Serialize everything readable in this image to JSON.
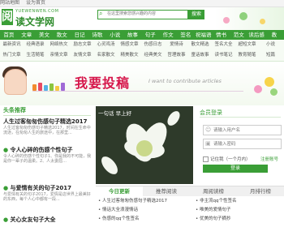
{
  "topbar": {
    "links": [
      "网站地图",
      "设为首页"
    ]
  },
  "header": {
    "logo_mark": "阅",
    "logo_url": "YUEWENWEN.COM",
    "logo_name": "读文学网",
    "search": {
      "placeholder": "在这里搜索您感兴趣的内容",
      "button": "搜索"
    }
  },
  "nav": [
    "首页",
    "文章",
    "美文",
    "散文",
    "日记",
    "诗歌",
    "小说",
    "故事",
    "句子",
    "作文",
    "签名",
    "祝福语",
    "情书",
    "范文",
    "读后感",
    "教"
  ],
  "subnav": [
    [
      "最新资讯",
      "经典语录",
      "网络热文",
      "励志文章",
      "心灵鸡汤",
      "情感文章",
      "伤感日志",
      "爱情诗",
      "散文精选",
      "签名大全",
      "超短文章",
      "小说"
    ],
    [
      "热门文章",
      "生活随笔",
      "亲情文章",
      "友情文章",
      "名家散文",
      "精美散文",
      "经典美文",
      "哲理故事",
      "童话故事",
      "读书笔记",
      "教育随笔",
      "短篇"
    ]
  ],
  "banner": {
    "title": "我要投稿",
    "subtitle": "I want to contribute articles"
  },
  "left": {
    "heading": "头条推荐",
    "items": [
      {
        "title": "人生过客匆匆伤感句子精选2017",
        "desc": "人生过客匆匆伤感句子精选2017，时间在生命中流逝，在匆匆人生的旅途中，在那里..."
      },
      {
        "title": "令人心碎的伤感个性句子",
        "desc": "令人心碎的伤感个性句子1、你是我的不可能，我是你一辈子的温柔。2、人太委屈..."
      },
      {
        "title": "与爱情有关的句子2017",
        "desc": "与爱情有关的句子2017，爱情是这世界上最美好的东西，每个人心中都有一段..."
      },
      {
        "title": "关心女友句子大全",
        "desc": ""
      }
    ]
  },
  "photo": {
    "caption": "一句话 早上好"
  },
  "tabs": [
    "今日更新",
    "推荐阅读",
    "周阅读榜",
    "月排行榜"
  ],
  "list_left": [
    "人生过客匆匆伤感句子精选2017",
    "情话大全浪漫情话",
    "伤感的qq个性签名"
  ],
  "list_right": [
    "非主流qq个性签名",
    "唯美的爱情句子",
    "优美的句子摘抄"
  ],
  "login": {
    "heading": "会员登录",
    "username_placeholder": "请输入用户名",
    "password_placeholder": "请输入密码",
    "remember": "记住我（一个月内）",
    "register": "注册账号",
    "button": "登录"
  }
}
